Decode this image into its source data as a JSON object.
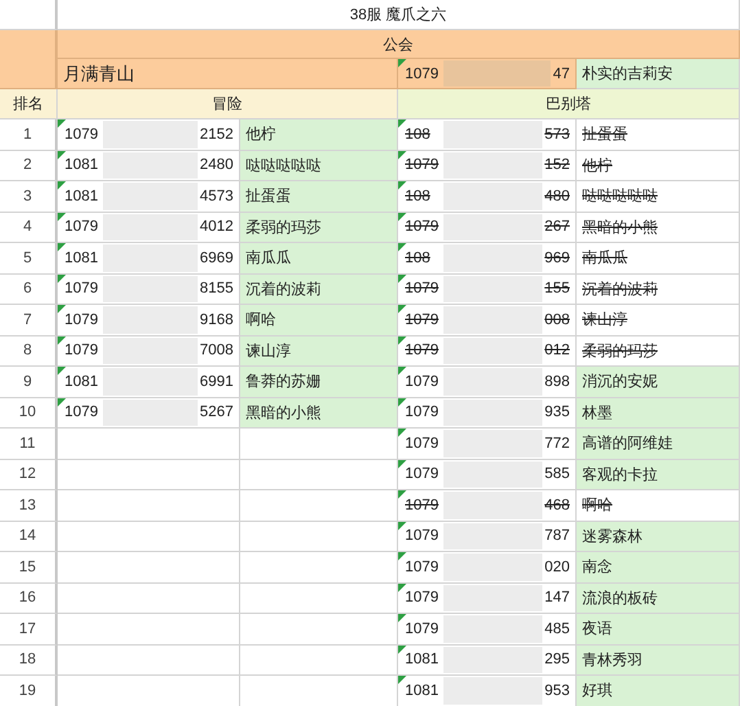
{
  "title": "38服 魔爪之六",
  "guild_header": "公会",
  "guild": {
    "name": "月满青山",
    "member": {
      "id_start": "1079",
      "id_end": "47",
      "name": "朴实的吉莉安"
    }
  },
  "rank_header": "排名",
  "sections": [
    "冒险",
    "巴别塔"
  ],
  "rows": [
    {
      "rank": "1",
      "left": {
        "id_start": "1079",
        "id_end": "2152",
        "name": "他柠"
      },
      "right": {
        "id_start": "108",
        "id_end": "573",
        "name": "扯蛋蛋",
        "struck": true
      }
    },
    {
      "rank": "2",
      "left": {
        "id_start": "1081",
        "id_end": "2480",
        "name": "哒哒哒哒哒"
      },
      "right": {
        "id_start": "1079",
        "id_end": "152",
        "name": "他柠",
        "struck": true
      }
    },
    {
      "rank": "3",
      "left": {
        "id_start": "1081",
        "id_end": "4573",
        "name": "扯蛋蛋"
      },
      "right": {
        "id_start": "108",
        "id_end": "480",
        "name": "哒哒哒哒哒",
        "struck": true
      }
    },
    {
      "rank": "4",
      "left": {
        "id_start": "1079",
        "id_end": "4012",
        "name": "柔弱的玛莎"
      },
      "right": {
        "id_start": "1079",
        "id_end": "267",
        "name": "黑暗的小熊",
        "struck": true
      }
    },
    {
      "rank": "5",
      "left": {
        "id_start": "1081",
        "id_end": "6969",
        "name": "南瓜瓜"
      },
      "right": {
        "id_start": "108",
        "id_end": "969",
        "name": "南瓜瓜",
        "struck": true
      }
    },
    {
      "rank": "6",
      "left": {
        "id_start": "1079",
        "id_end": "8155",
        "name": "沉着的波莉"
      },
      "right": {
        "id_start": "1079",
        "id_end": "155",
        "name": "沉着的波莉",
        "struck": true
      }
    },
    {
      "rank": "7",
      "left": {
        "id_start": "1079",
        "id_end": "9168",
        "name": "啊哈"
      },
      "right": {
        "id_start": "1079",
        "id_end": "008",
        "name": "谏山淳",
        "struck": true
      }
    },
    {
      "rank": "8",
      "left": {
        "id_start": "1079",
        "id_end": "7008",
        "name": "谏山淳"
      },
      "right": {
        "id_start": "1079",
        "id_end": "012",
        "name": "柔弱的玛莎",
        "struck": true
      }
    },
    {
      "rank": "9",
      "left": {
        "id_start": "1081",
        "id_end": "6991",
        "name": "鲁莽的苏姗"
      },
      "right": {
        "id_start": "1079",
        "id_end": "898",
        "name": "消沉的安妮",
        "struck": false
      }
    },
    {
      "rank": "10",
      "left": {
        "id_start": "1079",
        "id_end": "5267",
        "name": "黑暗的小熊"
      },
      "right": {
        "id_start": "1079",
        "id_end": "935",
        "name": "林墨",
        "struck": false
      }
    },
    {
      "rank": "11",
      "right": {
        "id_start": "1079",
        "id_end": "772",
        "name": "高谱的阿维娃",
        "struck": false
      }
    },
    {
      "rank": "12",
      "right": {
        "id_start": "1079",
        "id_end": "585",
        "name": "客观的卡拉",
        "struck": false
      }
    },
    {
      "rank": "13",
      "right": {
        "id_start": "1079",
        "id_end": "468",
        "name": "啊哈",
        "struck": true
      }
    },
    {
      "rank": "14",
      "right": {
        "id_start": "1079",
        "id_end": "787",
        "name": "迷雾森林",
        "struck": false
      }
    },
    {
      "rank": "15",
      "right": {
        "id_start": "1079",
        "id_end": "020",
        "name": "南念",
        "struck": false
      }
    },
    {
      "rank": "16",
      "right": {
        "id_start": "1079",
        "id_end": "147",
        "name": "流浪的板砖",
        "struck": false
      }
    },
    {
      "rank": "17",
      "right": {
        "id_start": "1079",
        "id_end": "485",
        "name": "夜语",
        "struck": false
      }
    },
    {
      "rank": "18",
      "right": {
        "id_start": "1081",
        "id_end": "295",
        "name": "青林秀羽",
        "struck": false
      }
    },
    {
      "rank": "19",
      "right": {
        "id_start": "1081",
        "id_end": "953",
        "name": "好琪",
        "struck": false
      }
    }
  ]
}
